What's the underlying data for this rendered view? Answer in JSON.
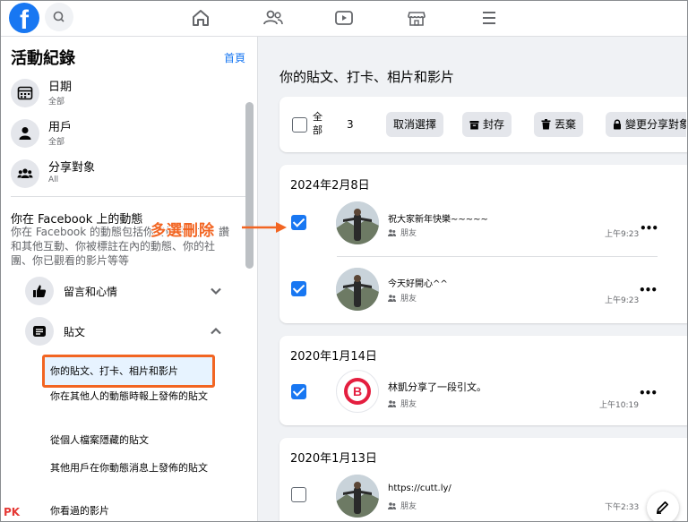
{
  "nav": {
    "logo_letter": "f",
    "icons": [
      "home-icon",
      "friends-icon",
      "watch-icon",
      "marketplace-icon",
      "menu-icon"
    ]
  },
  "sidebar": {
    "title": "活動紀錄",
    "home_link": "首頁",
    "filters": [
      {
        "label": "日期",
        "sub": "全部",
        "icon": "calendar-icon"
      },
      {
        "label": "用戶",
        "sub": "全部",
        "icon": "person-icon"
      },
      {
        "label": "分享對象",
        "sub": "All",
        "icon": "audience-icon"
      }
    ],
    "section_heading": "你在 Facebook 上的動態",
    "section_desc": "你在 Facebook 的動態包括你發佈的貼文、讚和其他互動、你被標註在內的動態、你的社團、你已觀看的影片等等",
    "categories": [
      {
        "label": "留言和心情",
        "icon": "thumbs-up-icon",
        "expanded": false
      },
      {
        "label": "貼文",
        "icon": "post-icon",
        "expanded": true
      }
    ],
    "sub_items": [
      "你的貼文、打卡、相片和影片",
      "你在其他人的動態時報上發佈的貼文",
      "從個人檔案隱藏的貼文",
      "其他用戶在你動態消息上發佈的貼文",
      "你看過的影片"
    ]
  },
  "main": {
    "title": "你的貼文、打卡、相片和影片",
    "toolbar": {
      "select_all": "全部",
      "count": "3",
      "deselect": "取消選擇",
      "archive": "封存",
      "trash": "丟棄",
      "change_audience": "變更分享對象"
    },
    "groups": [
      {
        "date": "2024年2月8日",
        "posts": [
          {
            "text": "祝大家新年快樂~~~~~",
            "audience": "朋友",
            "time": "上午9:23",
            "checked": true
          },
          {
            "text": "今天好開心^^",
            "audience": "朋友",
            "time": "上午9:23",
            "checked": true
          }
        ]
      },
      {
        "date": "2020年1月14日",
        "posts": [
          {
            "text": "林凱分享了一段引文。",
            "audience": "朋友",
            "time": "上午10:19",
            "checked": true
          }
        ]
      },
      {
        "date": "2020年1月13日",
        "posts": [
          {
            "text": "https://cutt.ly/",
            "audience": "朋友",
            "time": "下午2:33",
            "checked": false
          }
        ]
      }
    ]
  },
  "annotation": {
    "text": "多選刪除",
    "color": "#f26522"
  },
  "watermark": "PK",
  "colors": {
    "accent": "#1877f2",
    "annotation": "#f26522",
    "page_bg": "#f0f2f5"
  }
}
